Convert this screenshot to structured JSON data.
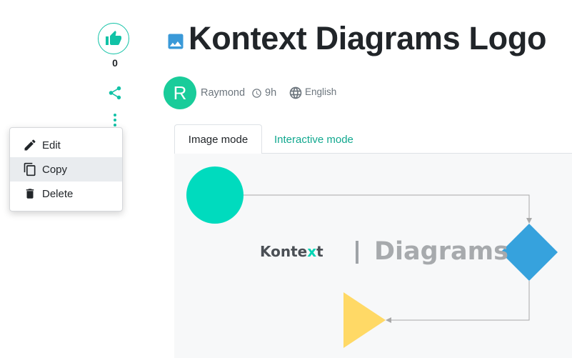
{
  "sidebar": {
    "like_count": "0",
    "menu": {
      "items": [
        {
          "label": "Edit",
          "icon": "pencil-icon"
        },
        {
          "label": "Copy",
          "icon": "copy-icon",
          "highlighted": true
        },
        {
          "label": "Delete",
          "icon": "trash-icon"
        }
      ]
    }
  },
  "header": {
    "title": "Kontext Diagrams Logo",
    "avatar_initial": "R",
    "author": "Raymond",
    "time": "9h",
    "language": "English"
  },
  "tabs": [
    {
      "label": "Image mode",
      "active": true
    },
    {
      "label": "Interactive mode",
      "active": false
    }
  ],
  "canvas": {
    "logo_kontext": "Konte",
    "logo_x": "x",
    "logo_t": "t",
    "logo_diagrams": "Diagrams"
  },
  "colors": {
    "accent": "#11c2a6",
    "avatar": "#19cc9a",
    "circle": "#00dbbe",
    "diamond": "#36a2dd",
    "triangle": "#ffd966",
    "connector": "#a9a9a9"
  }
}
